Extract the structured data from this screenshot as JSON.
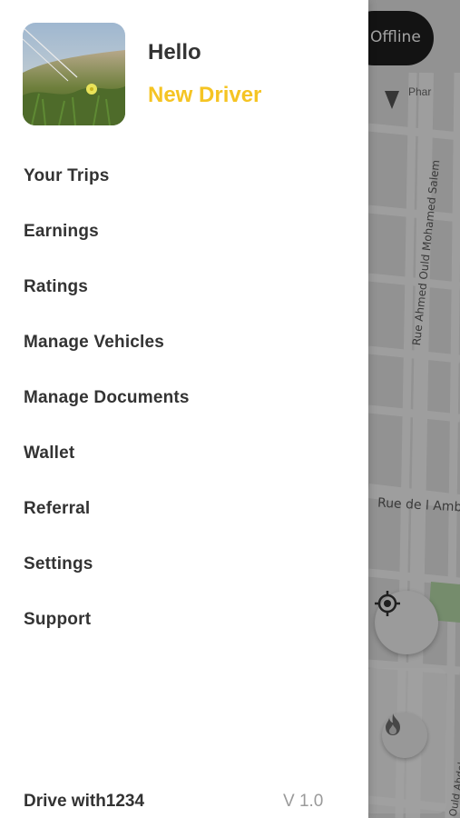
{
  "map": {
    "status_toggle_label": "Offline",
    "poi_label": "Phar",
    "streets": {
      "vertical": "Rue Ahmed Ould Mohamed Salem",
      "horizontal": "Rue de l Amb",
      "bottom": "Ould Abdel"
    },
    "colors": {
      "road": "#f6f6f6",
      "block": "#e2e2e2",
      "park": "#b7dbaa"
    }
  },
  "drawer": {
    "avatar_icon": "profile-photo",
    "greeting": "Hello",
    "driver_name": "New Driver",
    "accent_color": "#f5c423",
    "menu_items": [
      {
        "label": "Your Trips"
      },
      {
        "label": "Earnings"
      },
      {
        "label": "Ratings"
      },
      {
        "label": "Manage Vehicles"
      },
      {
        "label": "Manage Documents"
      },
      {
        "label": "Wallet"
      },
      {
        "label": "Referral"
      },
      {
        "label": "Settings"
      },
      {
        "label": "Support"
      }
    ],
    "footer": {
      "brand": "Drive with1234",
      "version": "V 1.0"
    }
  }
}
